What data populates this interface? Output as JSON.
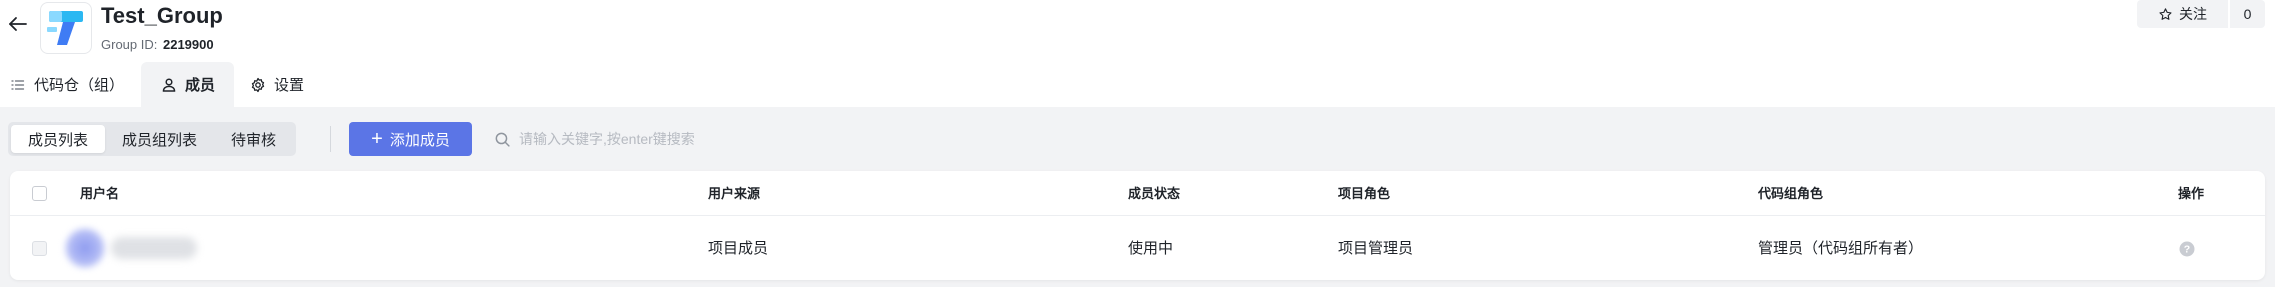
{
  "header": {
    "title": "Test_Group",
    "group_id_label": "Group ID:",
    "group_id_value": "2219900",
    "follow_label": "关注",
    "follow_count": "0"
  },
  "tabs": [
    {
      "label": "代码仓（组）",
      "icon": "list-icon"
    },
    {
      "label": "成员",
      "icon": "user-icon",
      "active": true
    },
    {
      "label": "设置",
      "icon": "gear-icon"
    }
  ],
  "toolbar": {
    "segments": [
      {
        "label": "成员列表",
        "active": true
      },
      {
        "label": "成员组列表"
      },
      {
        "label": "待审核"
      }
    ],
    "add_member_label": "添加成员",
    "search_placeholder": "请输入关键字,按enter键搜索"
  },
  "table": {
    "columns": [
      "用户名",
      "用户来源",
      "成员状态",
      "项目角色",
      "代码组角色",
      "操作"
    ],
    "rows": [
      {
        "username": "",
        "source": "项目成员",
        "status": "使用中",
        "project_role": "项目管理员",
        "group_role": "管理员（代码组所有者）"
      }
    ]
  },
  "colors": {
    "accent": "#5b75e6",
    "background": "#f2f3f5",
    "text": "#1f2329",
    "muted": "#646a73"
  }
}
